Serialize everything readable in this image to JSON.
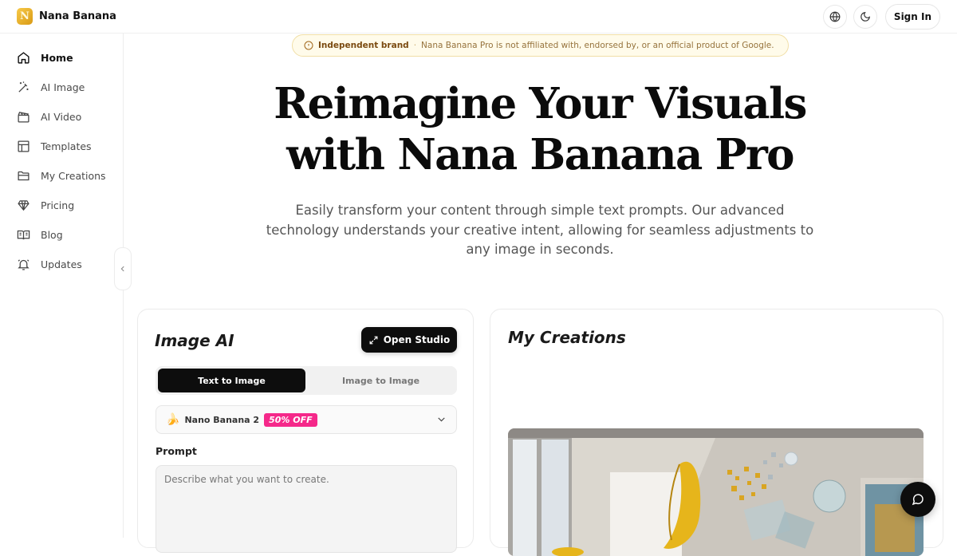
{
  "brand": {
    "name": "Nana Banana",
    "logo_letter": "N"
  },
  "topbar": {
    "signin_label": "Sign In",
    "icons": [
      "globe-icon",
      "moon-icon"
    ]
  },
  "sidebar": {
    "items": [
      {
        "label": "Home",
        "icon": "home-icon",
        "active": true
      },
      {
        "label": "AI Image",
        "icon": "magic-wand-icon",
        "active": false
      },
      {
        "label": "AI Video",
        "icon": "clapperboard-icon",
        "active": false
      },
      {
        "label": "Templates",
        "icon": "layout-icon",
        "active": false
      },
      {
        "label": "My Creations",
        "icon": "folder-icon",
        "active": false
      },
      {
        "label": "Pricing",
        "icon": "diamond-icon",
        "active": false
      },
      {
        "label": "Blog",
        "icon": "book-icon",
        "active": false
      },
      {
        "label": "Updates",
        "icon": "bell-icon",
        "active": false
      }
    ]
  },
  "notice": {
    "title": "Independent brand",
    "separator": "·",
    "text": "Nana Banana Pro is not affiliated with, endorsed by, or an official product of Google."
  },
  "hero": {
    "title_line1": "Reimagine Your Visuals",
    "title_line2": "with Nana Banana Pro",
    "subtitle": "Easily transform your content through simple text prompts. Our advanced technology understands your creative intent, allowing for seamless adjustments to any image in seconds."
  },
  "image_ai": {
    "title": "Image AI",
    "open_studio_label": "Open Studio",
    "tabs": [
      {
        "label": "Text to Image",
        "active": true
      },
      {
        "label": "Image to Image",
        "active": false
      }
    ],
    "model": {
      "emoji": "🍌",
      "name": "Nano Banana 2",
      "badge": "50% OFF"
    },
    "prompt_label": "Prompt",
    "prompt_placeholder": "Describe what you want to create."
  },
  "creations": {
    "title": "My Creations"
  },
  "colors": {
    "accent_badge": "#f5288a",
    "notice_bg": "#fffbea",
    "primary": "#0d0d0d"
  }
}
